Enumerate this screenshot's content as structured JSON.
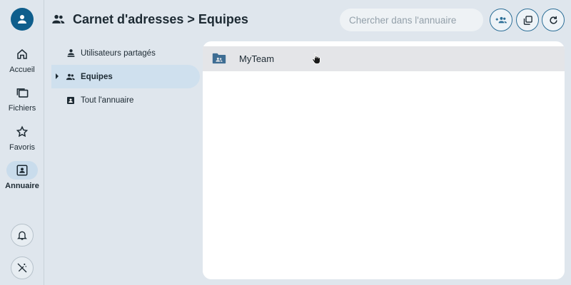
{
  "header": {
    "title": "Carnet d'adresses > Equipes",
    "search_placeholder": "Chercher dans l'annuaire",
    "actions": [
      {
        "icon": "add-group-icon"
      },
      {
        "icon": "copy-icon"
      },
      {
        "icon": "refresh-icon"
      }
    ]
  },
  "rail": {
    "items": [
      {
        "label": "Accueil",
        "icon": "home-icon",
        "active": false
      },
      {
        "label": "Fichiers",
        "icon": "files-icon",
        "active": false
      },
      {
        "label": "Favoris",
        "icon": "star-icon",
        "active": false
      },
      {
        "label": "Annuaire",
        "icon": "contact-card-icon",
        "active": true
      }
    ],
    "bottom": [
      {
        "icon": "bell-icon"
      },
      {
        "icon": "magic-off-icon"
      }
    ]
  },
  "sidebar": {
    "items": [
      {
        "label": "Utilisateurs partagés",
        "icon": "shared-user-icon",
        "active": false
      },
      {
        "label": "Equipes",
        "icon": "people-icon",
        "active": true,
        "expandable": true
      },
      {
        "label": "Tout l'annuaire",
        "icon": "contact-card-icon",
        "active": false
      }
    ]
  },
  "list": {
    "rows": [
      {
        "label": "MyTeam",
        "icon": "team-folder-icon"
      }
    ]
  },
  "colors": {
    "accent": "#0f5e8c",
    "background": "#dfe6ed",
    "active_item": "#cfe0ee",
    "row_hover": "#e4e5e8",
    "panel": "#ffffff"
  }
}
